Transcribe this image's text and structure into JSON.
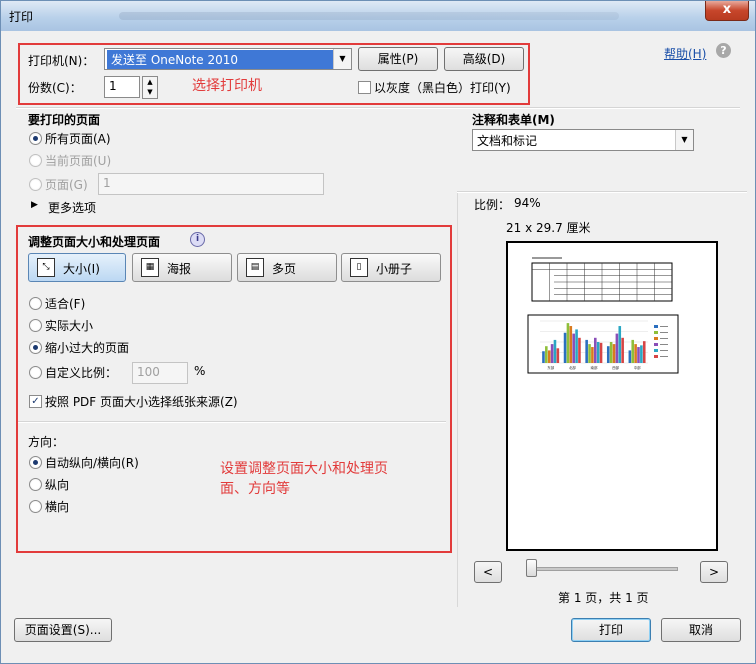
{
  "window": {
    "title": "打印",
    "close_glyph": "x"
  },
  "help_link": "帮助(H)",
  "printer": {
    "printer_label": "打印机(N)：",
    "printer_value": "发送至 OneNote 2010",
    "properties_button": "属性(P)",
    "advanced_button": "高级(D)",
    "copies_label": "份数(C)：",
    "copies_value": "1",
    "grayscale_label": "以灰度（黑白色）打印(Y)",
    "annotation_note": "选择打印机"
  },
  "pages_to_print": {
    "heading": "要打印的页面",
    "all_pages": "所有页面(A)",
    "current_page": "当前页面(U)",
    "pages": "页面(G)",
    "pages_value": "1",
    "more_options": "更多选项"
  },
  "sizing": {
    "heading": "调整页面大小和处理页面",
    "info_glyph": "i",
    "buttons": [
      "大小(I)",
      "海报",
      "多页",
      "小册子"
    ],
    "fit": "适合(F)",
    "actual_size": "实际大小",
    "shrink_oversized": "缩小过大的页面",
    "custom_scale": "自定义比例：",
    "custom_scale_value": "100",
    "percent_sign": "%",
    "choose_paper_source": "按照 PDF 页面大小选择纸张来源(Z)"
  },
  "orientation": {
    "heading": "方向：",
    "auto": "自动纵向/横向(R)",
    "portrait": "纵向",
    "landscape": "横向",
    "annotation_note": "设置调整页面大小和处理页面、方向等"
  },
  "comments": {
    "heading": "注释和表单(M)",
    "value": "文档和标记"
  },
  "preview": {
    "scale_label": "比例：",
    "scale_value": "94%",
    "paper_size": "21 x 29.7 厘米",
    "prev_button": "<",
    "next_button": ">",
    "page_status": "第 1 页，共 1 页"
  },
  "footer": {
    "page_setup_button": "页面设置(S)...",
    "print_button": "打印",
    "cancel_button": "取消"
  },
  "chart_data": {
    "type": "bar",
    "categories": [
      "东部",
      "北部",
      "南部",
      "西部",
      "中部"
    ],
    "series": [
      {
        "name": "",
        "values": [
          28,
          72,
          55,
          40,
          30
        ]
      },
      {
        "name": "",
        "values": [
          40,
          95,
          45,
          50,
          55
        ]
      },
      {
        "name": "",
        "values": [
          30,
          88,
          38,
          45,
          45
        ]
      },
      {
        "name": "",
        "values": [
          45,
          70,
          60,
          70,
          38
        ]
      },
      {
        "name": "",
        "values": [
          55,
          80,
          50,
          88,
          42
        ]
      },
      {
        "name": "",
        "values": [
          35,
          60,
          48,
          60,
          52
        ]
      }
    ],
    "series_colors": [
      "#2b6fbf",
      "#8fbf3a",
      "#d97a1f",
      "#8a4fb8",
      "#2aa7c4",
      "#d64545"
    ],
    "ylim": [
      0,
      100
    ],
    "title": "",
    "xlabel": "",
    "ylabel": ""
  }
}
